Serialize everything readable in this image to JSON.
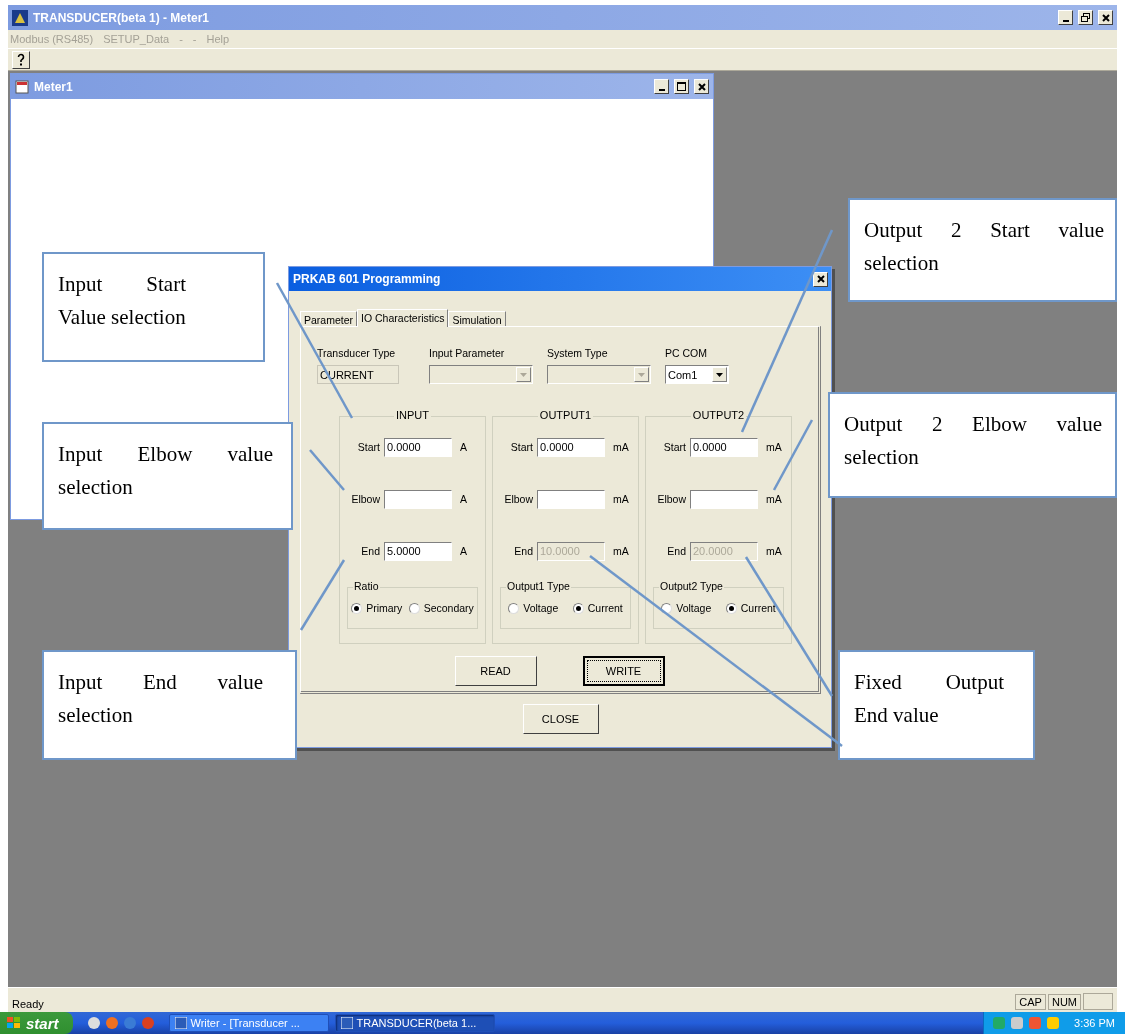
{
  "app_window": {
    "title": "TRANSDUCER(beta 1) - Meter1",
    "menu": [
      "Modbus (RS485)",
      "SETUP_Data",
      "-",
      "-",
      "Help"
    ]
  },
  "child_window": {
    "title": "Meter1"
  },
  "dialog": {
    "title": "PRKAB 601 Programming",
    "tabs": [
      {
        "label": "Parameter",
        "selected": false
      },
      {
        "label": "IO Characteristics",
        "selected": true
      },
      {
        "label": "Simulation",
        "selected": false
      }
    ],
    "fields": [
      {
        "label": "Transducer Type",
        "kind": "readonly",
        "value": "CURRENT"
      },
      {
        "label": "Input Parameter",
        "kind": "combo",
        "disabled": true
      },
      {
        "label": "System Type",
        "kind": "combo",
        "disabled": true
      },
      {
        "label": "PC COM",
        "kind": "combo",
        "value": "Com1",
        "disabled": false
      }
    ],
    "groups": [
      {
        "title": "INPUT",
        "rows": [
          {
            "label": "Start",
            "value": "0.0000",
            "unit": "A",
            "disabled": false
          },
          {
            "label": "Elbow",
            "unit": "A",
            "disabled": false
          },
          {
            "label": "End",
            "value": "5.0000",
            "unit": "A",
            "disabled": false
          }
        ],
        "options_title": "Ratio",
        "options": [
          {
            "label": "Primary",
            "selected": true
          },
          {
            "label": "Secondary",
            "selected": false
          }
        ]
      },
      {
        "title": "OUTPUT1",
        "rows": [
          {
            "label": "Start",
            "value": "0.0000",
            "unit": "mA",
            "disabled": false
          },
          {
            "label": "Elbow",
            "unit": "mA",
            "disabled": false
          },
          {
            "label": "End",
            "value": "10.0000",
            "unit": "mA",
            "disabled": true
          }
        ],
        "options_title": "Output1 Type",
        "options": [
          {
            "label": "Voltage",
            "selected": false
          },
          {
            "label": "Current",
            "selected": true
          }
        ]
      },
      {
        "title": "OUTPUT2",
        "rows": [
          {
            "label": "Start",
            "value": "0.0000",
            "unit": "mA",
            "disabled": false
          },
          {
            "label": "Elbow",
            "unit": "mA",
            "disabled": false
          },
          {
            "label": "End",
            "value": "20.0000",
            "unit": "mA",
            "disabled": true
          }
        ],
        "options_title": "Output2 Type",
        "options": [
          {
            "label": "Voltage",
            "selected": false
          },
          {
            "label": "Current",
            "selected": true
          }
        ]
      }
    ],
    "buttons": [
      {
        "label": "READ",
        "focused": false
      },
      {
        "label": "WRITE",
        "focused": true
      }
    ],
    "close_button": "CLOSE"
  },
  "callouts": [
    {
      "text": "Input Start Value selection"
    },
    {
      "text": "Input Elbow value selection"
    },
    {
      "text": "Input End value selection"
    },
    {
      "text": "Output 2 Start value selection"
    },
    {
      "text": "Output 2 Elbow value selection"
    },
    {
      "text": "Fixed Output End value"
    }
  ],
  "status_bar": {
    "text": "Ready",
    "indicators": [
      "CAP",
      "NUM"
    ]
  },
  "taskbar": {
    "start": "start",
    "tasks": [
      {
        "label": "Writer - [Transducer ...",
        "selected": false
      },
      {
        "label": "TRANSDUCER(beta 1...",
        "selected": true
      }
    ],
    "clock": "3:36 PM"
  }
}
